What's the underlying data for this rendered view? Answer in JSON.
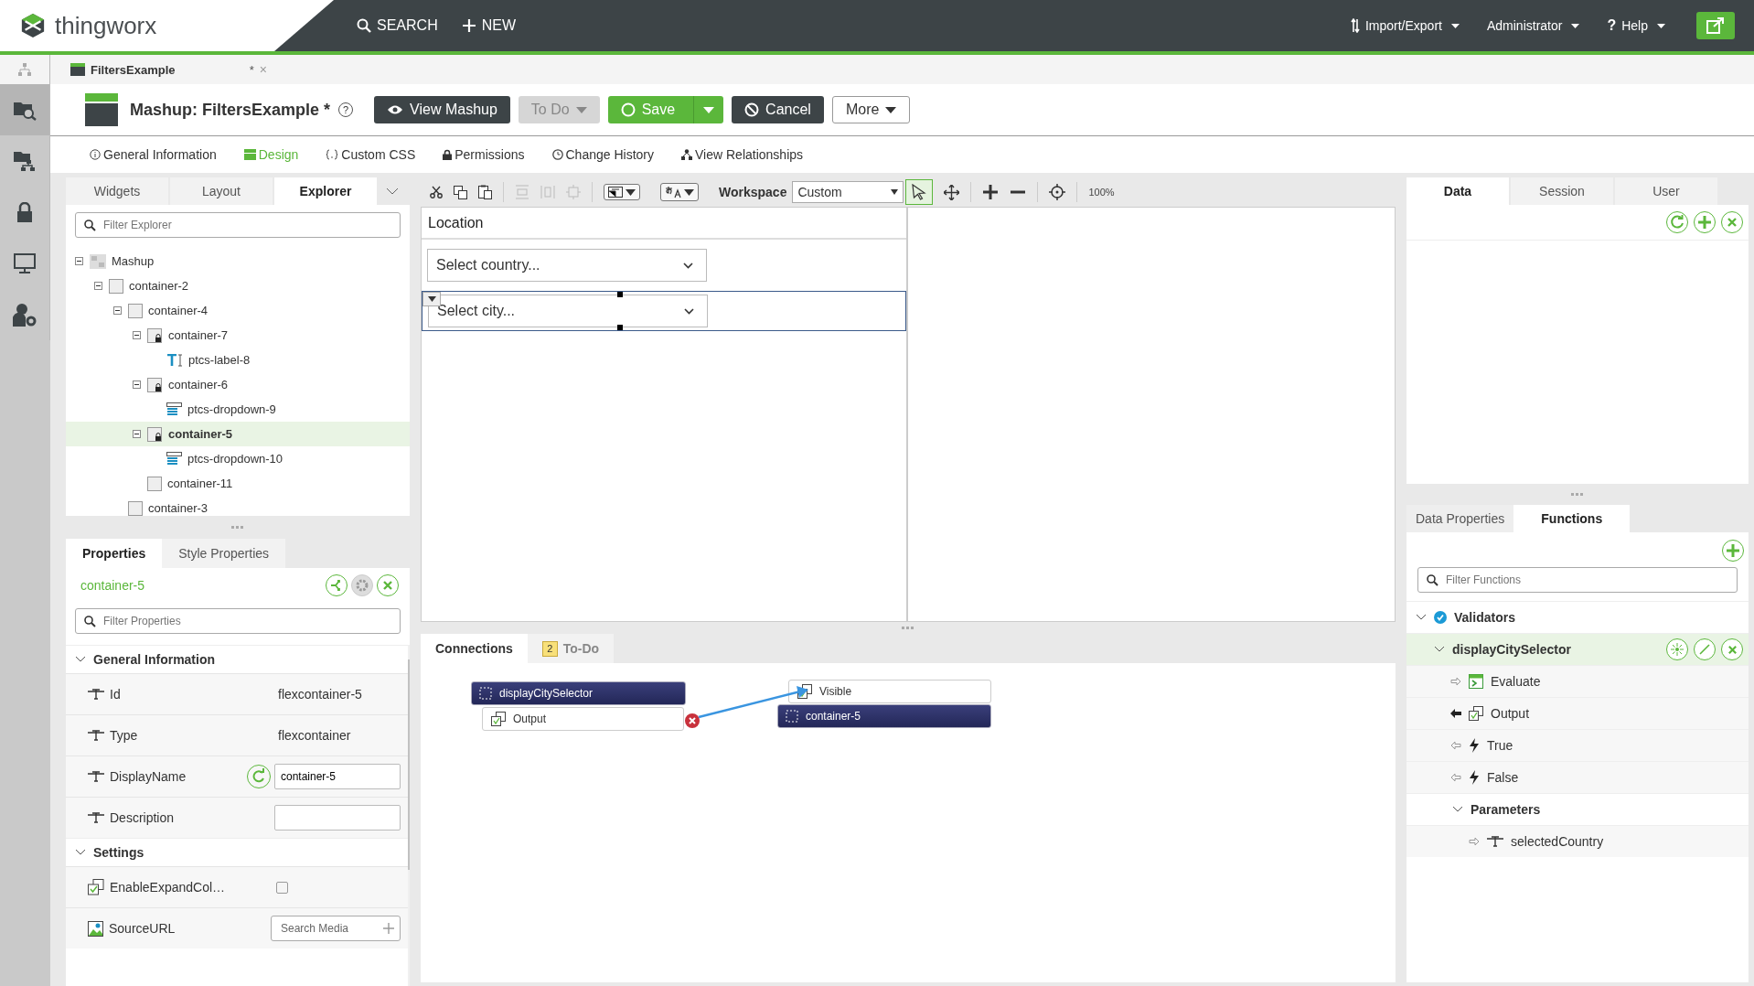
{
  "app": {
    "logo": "thingworx",
    "nav": [
      "SEARCH",
      "NEW"
    ],
    "menus": [
      "Import/Export",
      "Administrator",
      "Help"
    ],
    "help_mark": "?"
  },
  "rail": [
    {
      "selected": false
    },
    {
      "selected": true
    },
    {
      "selected": false
    },
    {
      "selected": false
    },
    {
      "selected": false
    },
    {
      "selected": false
    }
  ],
  "document_tab": {
    "title": "FiltersExample",
    "mark": "*",
    "close": "×"
  },
  "header": {
    "title": "Mashup: FiltersExample *",
    "help": "?",
    "buttons": [
      {
        "label": "View Mashup",
        "kind": "dark"
      },
      {
        "label": "To Do",
        "kind": "disabled"
      },
      {
        "label": "Save",
        "kind": "primary"
      },
      {
        "label": "Cancel",
        "kind": "dark"
      },
      {
        "label": "More",
        "kind": "outline"
      }
    ]
  },
  "subnav": [
    {
      "label": "General Information",
      "selected": false
    },
    {
      "label": "Design",
      "selected": true
    },
    {
      "label": "Custom CSS",
      "selected": false
    },
    {
      "label": "Permissions",
      "selected": false
    },
    {
      "label": "Change History",
      "selected": false
    },
    {
      "label": "View Relationships",
      "selected": false
    }
  ],
  "left_tabs": [
    {
      "label": "Widgets",
      "selected": false
    },
    {
      "label": "Layout",
      "selected": false
    },
    {
      "label": "Explorer",
      "selected": true
    }
  ],
  "explorer": {
    "placeholder": "Filter Explorer",
    "tree": [
      {
        "label": "Mashup",
        "kind": "mashup",
        "selected": false,
        "expanded": true,
        "children": [
          {
            "label": "container-2",
            "kind": "container",
            "selected": false,
            "expanded": true,
            "children": [
              {
                "label": "container-4",
                "kind": "container",
                "selected": false,
                "expanded": true,
                "children": [
                  {
                    "label": "container-7",
                    "kind": "locked",
                    "selected": false,
                    "expanded": true,
                    "children": [
                      {
                        "label": "ptcs-label-8",
                        "kind": "label",
                        "selected": false
                      }
                    ]
                  },
                  {
                    "label": "container-6",
                    "kind": "locked",
                    "selected": false,
                    "expanded": true,
                    "children": [
                      {
                        "label": "ptcs-dropdown-9",
                        "kind": "dropdown",
                        "selected": false
                      }
                    ]
                  },
                  {
                    "label": "container-5",
                    "kind": "locked",
                    "selected": true,
                    "expanded": true,
                    "children": [
                      {
                        "label": "ptcs-dropdown-10",
                        "kind": "dropdown",
                        "selected": false
                      }
                    ]
                  },
                  {
                    "label": "container-11",
                    "kind": "container",
                    "selected": false
                  }
                ]
              },
              {
                "label": "container-3",
                "kind": "container",
                "selected": false
              }
            ]
          }
        ]
      }
    ]
  },
  "properties": {
    "tabs": [
      {
        "label": "Properties",
        "selected": true
      },
      {
        "label": "Style Properties",
        "selected": false
      }
    ],
    "widget": "container-5",
    "placeholder": "Filter Properties",
    "groups": [
      {
        "title": "General Information",
        "expanded": true,
        "rows": [
          {
            "name": "Id",
            "kind": "text",
            "value": "flexcontainer-5"
          },
          {
            "name": "Type",
            "kind": "text",
            "value": "flexcontainer"
          },
          {
            "name": "DisplayName",
            "kind": "input",
            "value": "container-5"
          },
          {
            "name": "Description",
            "kind": "input"
          }
        ]
      },
      {
        "title": "Settings",
        "expanded": true,
        "rows": [
          {
            "name": "EnableExpandCol…",
            "kind": "checkbox",
            "checked": false
          },
          {
            "name": "SourceURL",
            "kind": "media",
            "placeholder": "Search Media"
          }
        ]
      }
    ]
  },
  "toolbar": {
    "workspace_label": "Workspace",
    "workspace": "Custom",
    "zoom": "100%"
  },
  "canvas": {
    "title": "Location",
    "dropdowns": [
      {
        "placeholder": "Select country...",
        "selected": false
      },
      {
        "placeholder": "Select city...",
        "selected": true
      }
    ]
  },
  "connections": {
    "tabs": [
      {
        "label": "Connections",
        "selected": true
      },
      {
        "label": "To-Do",
        "selected": false,
        "badge": "2"
      }
    ],
    "source": {
      "name": "displayCitySelector",
      "port": "Output"
    },
    "target": {
      "name": "container-5",
      "port": "Visible"
    }
  },
  "right_tabs": [
    {
      "label": "Data",
      "selected": true
    },
    {
      "label": "Session",
      "selected": false
    },
    {
      "label": "User",
      "selected": false
    }
  ],
  "functions": {
    "tabs": [
      {
        "label": "Data Properties",
        "selected": false
      },
      {
        "label": "Functions",
        "selected": true
      }
    ],
    "placeholder": "Filter Functions",
    "group": {
      "label": "Validators",
      "expanded": true
    },
    "function": {
      "name": "displayCitySelector",
      "selected": true,
      "expanded": true,
      "members": [
        {
          "label": "Evaluate",
          "kind": "service"
        },
        {
          "label": "Output",
          "kind": "output"
        },
        {
          "label": "True",
          "kind": "event"
        },
        {
          "label": "False",
          "kind": "event"
        }
      ],
      "parameters": {
        "label": "Parameters",
        "expanded": true,
        "items": [
          {
            "label": "selectedCountry"
          }
        ]
      }
    }
  }
}
